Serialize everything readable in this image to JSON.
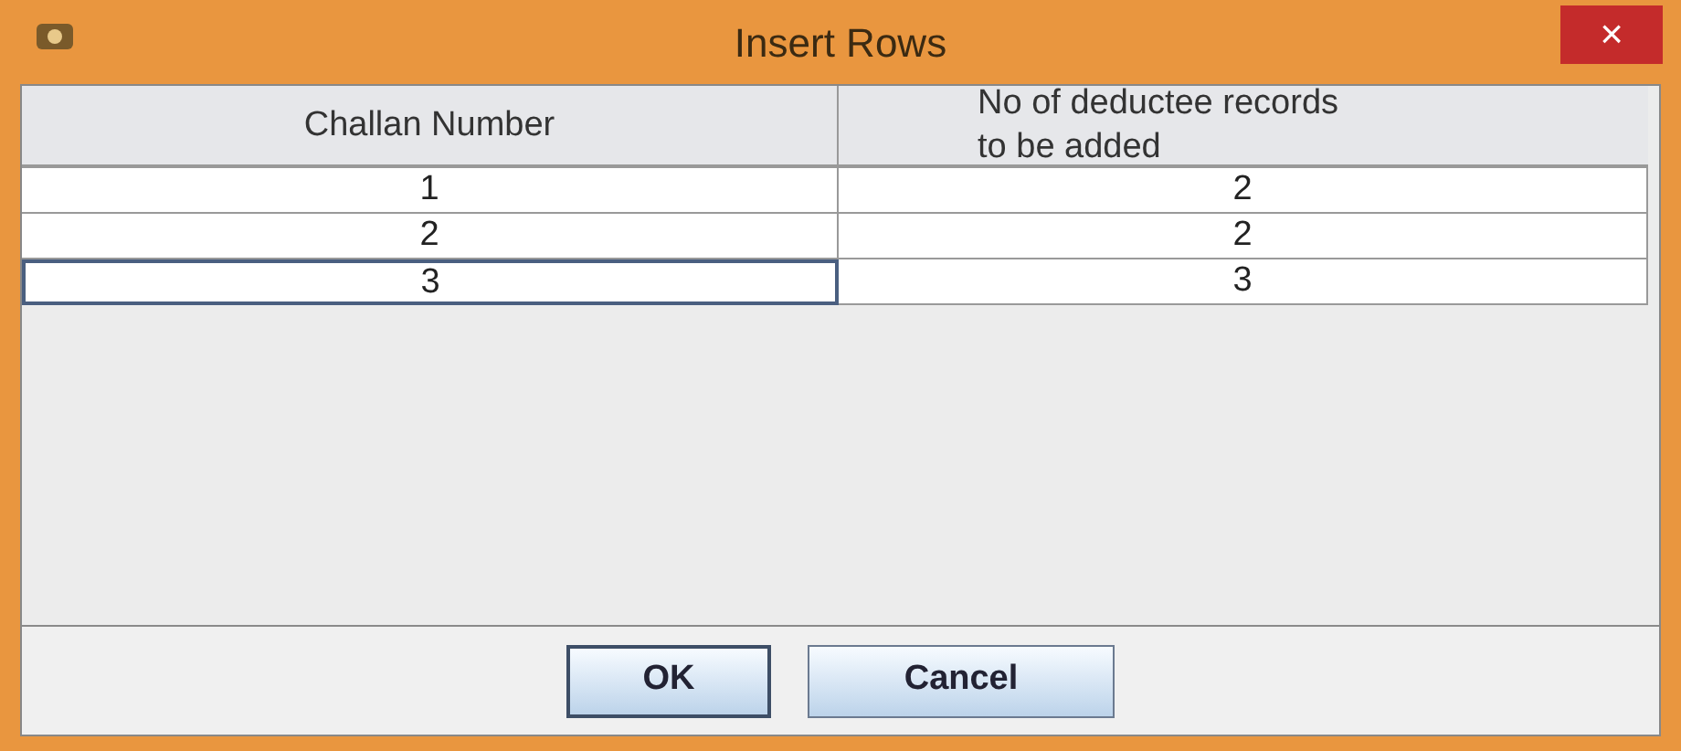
{
  "window": {
    "title": "Insert Rows",
    "close": "×"
  },
  "table": {
    "columns": [
      "Challan Number",
      "No of deductee records\nto be added"
    ],
    "rows": [
      {
        "cells": [
          "1",
          "2"
        ],
        "selected": false
      },
      {
        "cells": [
          "2",
          "2"
        ],
        "selected": false
      },
      {
        "cells": [
          "3",
          "3"
        ],
        "selected": true
      }
    ]
  },
  "buttons": [
    {
      "label": "OK",
      "focused": true
    },
    {
      "label": "Cancel",
      "focused": false
    }
  ]
}
